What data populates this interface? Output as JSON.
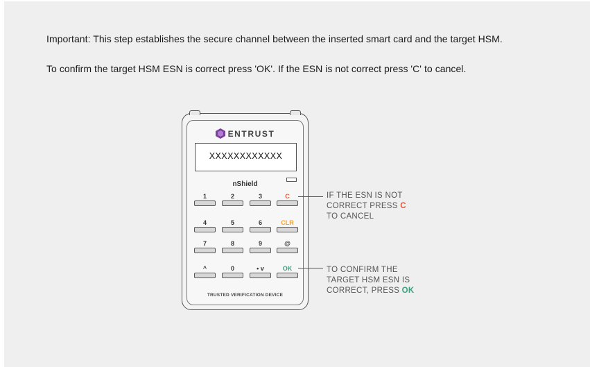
{
  "instructions": {
    "line1": "Important: This step establishes the secure channel between the inserted smart card and the target HSM.",
    "line2": "To confirm the target HSM ESN is correct press 'OK'. If the ESN is not correct press 'C' to cancel."
  },
  "device": {
    "brand": "ENTRUST",
    "brand_icon": "entrust-hex-logo-icon",
    "screen_text": "XXXXXXXXXXXX",
    "model": "nShield",
    "footer": "TRUSTED VERIFICATION DEVICE",
    "keys": [
      [
        "1",
        "2",
        "3",
        "C"
      ],
      [
        "4",
        "5",
        "6",
        "CLR"
      ],
      [
        "7",
        "8",
        "9",
        "@"
      ],
      [
        "^",
        "0",
        "• v",
        "OK"
      ]
    ],
    "colors": {
      "c_key": "#e05a3a",
      "clr_key": "#f0a03a",
      "ok_key": "#3aa37c",
      "logo": "#7b3fa0"
    }
  },
  "callouts": {
    "cancel": {
      "line1": "IF THE ESN IS NOT",
      "line2_prefix": "CORRECT PRESS ",
      "line2_key": "C",
      "line3": "TO CANCEL"
    },
    "confirm": {
      "line1": "TO CONFIRM THE",
      "line2": "TARGET HSM ESN IS",
      "line3_prefix": "CORRECT, PRESS ",
      "line3_key": "OK"
    }
  }
}
